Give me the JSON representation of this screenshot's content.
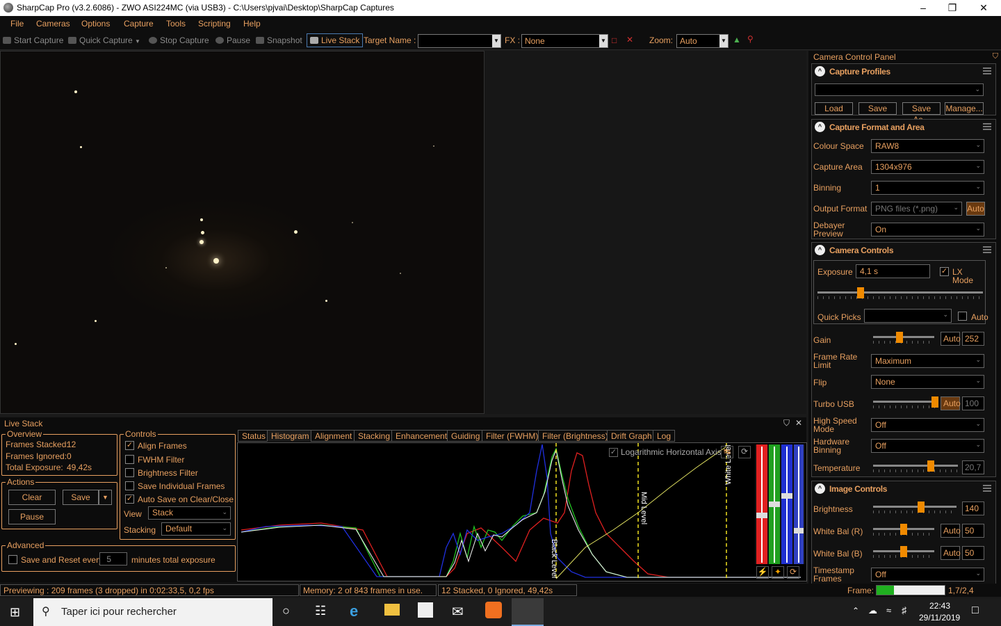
{
  "window": {
    "title": "SharpCap Pro (v3.2.6086) - ZWO ASI224MC (via USB3) - C:\\Users\\pjvai\\Desktop\\SharpCap Captures",
    "minimize": "–",
    "maximize": "❐",
    "close": "✕"
  },
  "menu": [
    "File",
    "Cameras",
    "Options",
    "Capture",
    "Tools",
    "Scripting",
    "Help"
  ],
  "toolbar": {
    "start_capture": "Start Capture",
    "quick_capture": "Quick Capture",
    "stop_capture": "Stop Capture",
    "pause": "Pause",
    "snapshot": "Snapshot",
    "live_stack": "Live Stack",
    "target_name_label": "Target Name :",
    "target_name_value": "",
    "fx_label": "FX :",
    "fx_value": "None",
    "zoom_label": "Zoom:",
    "zoom_value": "Auto"
  },
  "camera_panel": {
    "title": "Camera Control Panel",
    "capture_profiles": {
      "header": "Capture Profiles",
      "profile_value": "",
      "load": "Load",
      "save": "Save",
      "save_as": "Save As...",
      "manage": "Manage..."
    },
    "format": {
      "header": "Capture Format and Area",
      "colour_space_label": "Colour Space",
      "colour_space": "RAW8",
      "capture_area_label": "Capture Area",
      "capture_area": "1304x976",
      "binning_label": "Binning",
      "binning": "1",
      "output_format_label": "Output Format",
      "output_format": "PNG files (*.png)",
      "output_auto": "Auto",
      "debayer_label": "Debayer Preview",
      "debayer": "On"
    },
    "controls": {
      "header": "Camera Controls",
      "exposure_label": "Exposure",
      "exposure": "4,1 s",
      "lx_mode": "LX Mode",
      "exposure_level": 0.25,
      "quick_picks_label": "Quick Picks",
      "quick_picks": "",
      "quick_auto": "Auto",
      "gain_label": "Gain",
      "gain_auto": "Auto",
      "gain": "252",
      "gain_level": 0.42,
      "frame_rate_label": "Frame Rate Limit",
      "frame_rate": "Maximum",
      "flip_label": "Flip",
      "flip": "None",
      "turbo_usb_label": "Turbo USB",
      "turbo_auto": "Auto",
      "turbo_value": "100",
      "turbo_level": 1.0,
      "high_speed_label": "High Speed Mode",
      "high_speed": "Off",
      "hw_binning_label": "Hardware Binning",
      "hw_binning": "Off",
      "temperature_label": "Temperature",
      "temperature": "20,7",
      "temperature_level": 0.7
    },
    "image": {
      "header": "Image Controls",
      "brightness_label": "Brightness",
      "brightness": "140",
      "brightness_level": 0.58,
      "wb_r_label": "White Bal (R)",
      "wb_r_auto": "Auto",
      "wb_r": "50",
      "wb_r_level": 0.5,
      "wb_b_label": "White Bal (B)",
      "wb_b_auto": "Auto",
      "wb_b": "50",
      "wb_b_level": 0.5,
      "timestamp_label": "Timestamp Frames",
      "timestamp": "Off"
    }
  },
  "live_stack": {
    "title": "Live Stack",
    "overview": {
      "title": "Overview",
      "frames_stacked_label": "Frames Stacked:",
      "frames_stacked": "12",
      "frames_ignored_label": "Frames Ignored:",
      "frames_ignored": "0",
      "total_exposure_label": "Total Exposure:",
      "total_exposure": "49,42s"
    },
    "actions": {
      "title": "Actions",
      "clear": "Clear",
      "save": "Save",
      "pause": "Pause"
    },
    "advanced": {
      "title": "Advanced",
      "save_reset_label": "Save and Reset every",
      "minutes": "5",
      "minutes_suffix": "minutes total exposure"
    },
    "controls": {
      "title": "Controls",
      "align_frames": "Align Frames",
      "fwhm_filter": "FWHM Filter",
      "brightness_filter": "Brightness Filter",
      "save_individual": "Save Individual Frames",
      "auto_save": "Auto Save on Clear/Close",
      "view_label": "View",
      "view": "Stack",
      "stacking_label": "Stacking",
      "stacking": "Default"
    },
    "tabs": [
      "Status",
      "Histogram",
      "Alignment",
      "Stacking",
      "Enhancement",
      "Guiding",
      "Filter (FWHM)",
      "Filter (Brightness)",
      "Drift Graph",
      "Log"
    ],
    "active_tab": "Histogram",
    "histogram": {
      "log_axis": "Logarithmic Horizontal Axis",
      "black_level": "Black Level",
      "mid_level": "Mid Level",
      "white_level": "White Level"
    }
  },
  "status": {
    "previewing": "Previewing : 209 frames (3 dropped) in 0:02:33,5, 0,2 fps",
    "memory": "Memory: 2 of 843 frames in use.",
    "stack_summary": "12 Stacked, 0 Ignored, 49,42s",
    "frame_label": "Frame:",
    "frame_value": "1,7/2,4"
  },
  "taskbar": {
    "search_placeholder": "Taper ici pour rechercher",
    "time": "22:43",
    "date": "29/11/2019"
  }
}
